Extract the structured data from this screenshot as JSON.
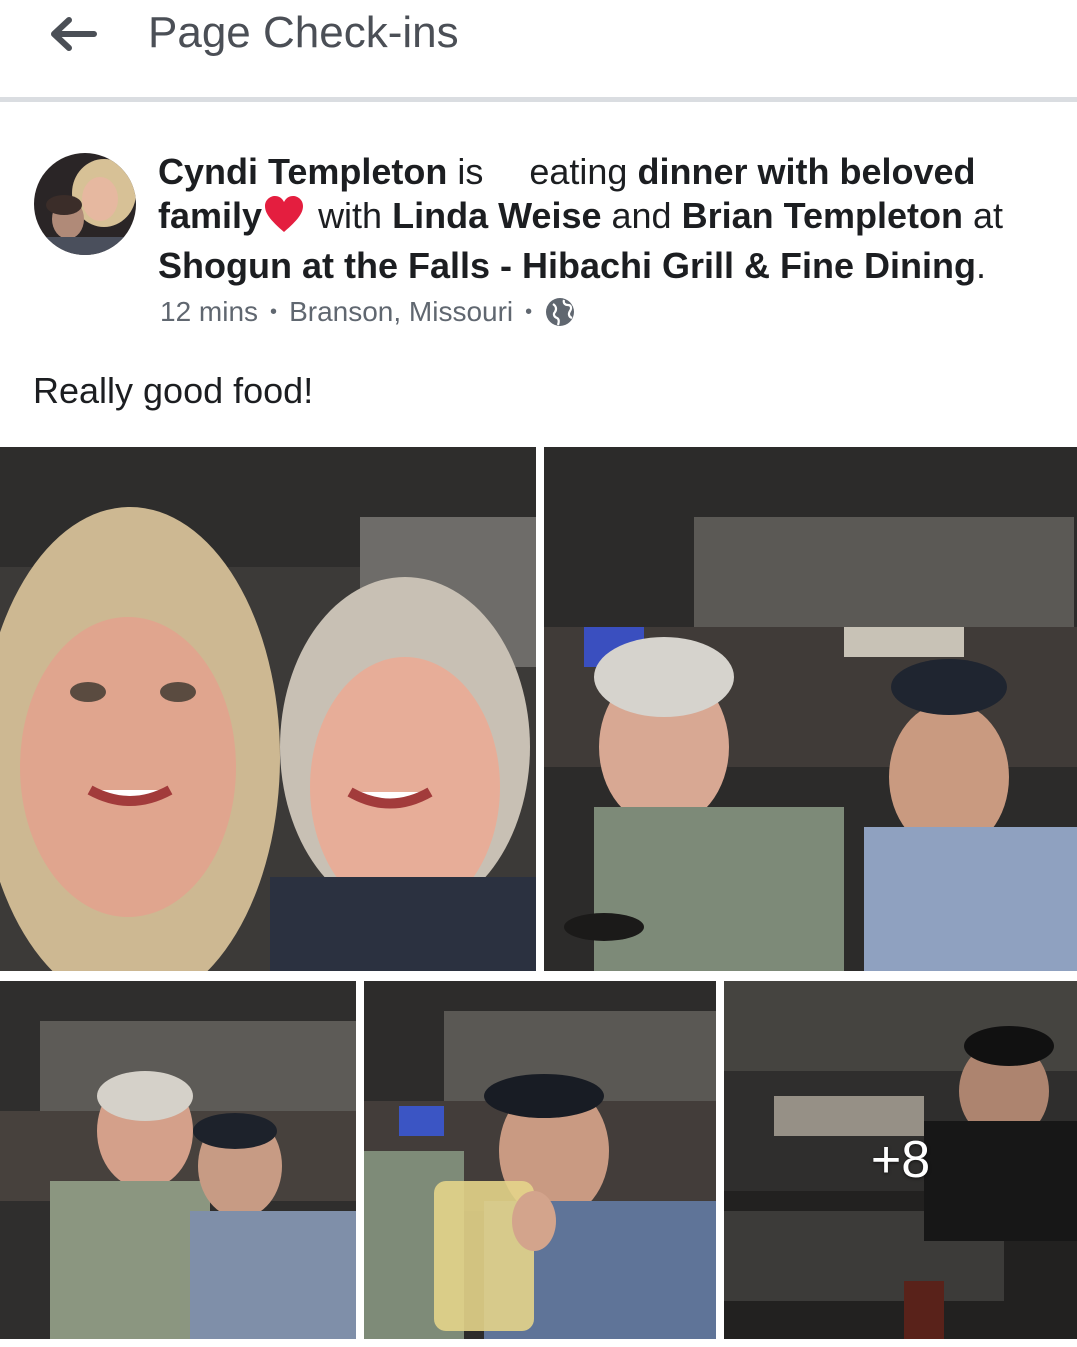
{
  "header": {
    "title": "Page Check-ins",
    "back_icon": "arrow-left-icon"
  },
  "post": {
    "author": "Cyndi Templeton",
    "is_word": "is",
    "activity_verb": "eating",
    "activity_object": "dinner with beloved family",
    "heart_icon": "red-heart-icon",
    "with_word": "with",
    "tag_1": "Linda Weise",
    "and_word": "and",
    "tag_2": "Brian Templeton",
    "at_word": "at",
    "place": "Shogun at the Falls - Hibachi Grill & Fine Dining",
    "period": ".",
    "time": "12 mins",
    "location": "Branson, Missouri",
    "privacy_icon": "globe-icon",
    "text": "Really good food!",
    "more_photos": "+8"
  },
  "colors": {
    "text_primary": "#1c1e21",
    "text_secondary": "#606770",
    "divider": "#dadde1",
    "heart": "#e41e3f"
  }
}
